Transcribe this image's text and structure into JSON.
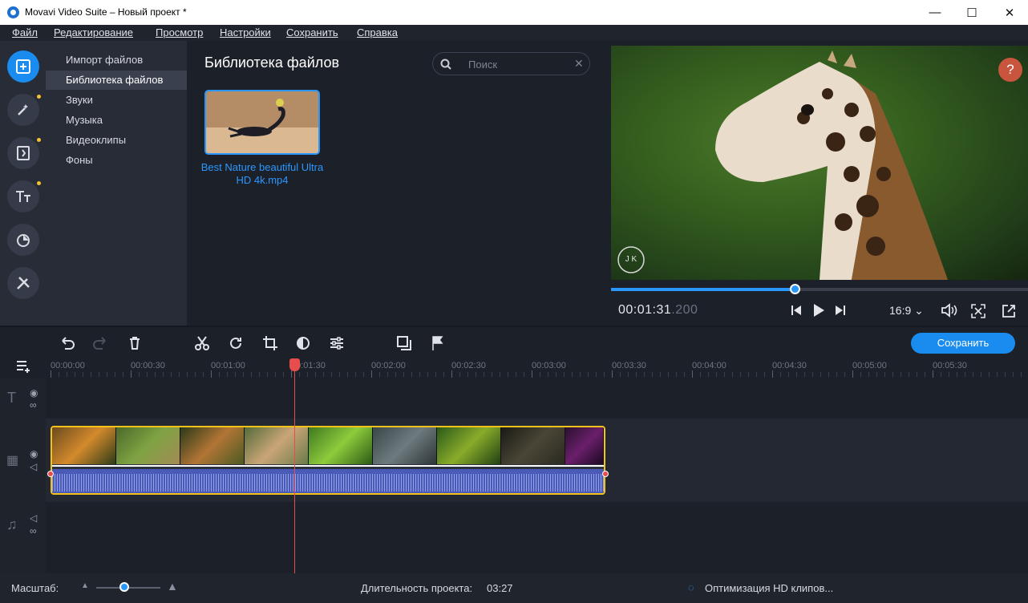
{
  "window": {
    "title": "Movavi Video Suite – Новый проект *",
    "minimize": "—",
    "maximize": "☐",
    "close": "✕"
  },
  "menu": [
    "Файл",
    "Редактирование",
    "Просмотр",
    "Настройки",
    "Сохранить",
    "Справка"
  ],
  "sidebar_tools": [
    {
      "name": "import-icon",
      "active": true,
      "dot": false
    },
    {
      "name": "magic-wand-icon",
      "active": false,
      "dot": true
    },
    {
      "name": "transitions-icon",
      "active": false,
      "dot": true
    },
    {
      "name": "titles-icon",
      "active": false,
      "dot": true
    },
    {
      "name": "filters-icon",
      "active": false,
      "dot": false
    },
    {
      "name": "tools-icon",
      "active": false,
      "dot": false
    }
  ],
  "categories": [
    "Импорт файлов",
    "Библиотека файлов",
    "Звуки",
    "Музыка",
    "Видеоклипы",
    "Фоны"
  ],
  "active_category": 1,
  "library": {
    "title": "Библиотека файлов",
    "search_placeholder": "Поиск",
    "file_label": "Best Nature beautiful Ultra HD 4k.mp4"
  },
  "player": {
    "help": "?",
    "time_main": "00:01:31",
    "time_ms": ".200",
    "aspect": "16:9 ⌄",
    "progress": 0.44,
    "watermark": "J K"
  },
  "toolbar": {
    "save_label": "Сохранить"
  },
  "ruler_ticks": [
    "00:00:00",
    "00:00:30",
    "00:01:00",
    "00:01:30",
    "00:02:00",
    "00:02:30",
    "00:03:00",
    "00:03:30",
    "00:04:00",
    "00:04:30",
    "00:05:00",
    "00:05:30"
  ],
  "status": {
    "zoom_label": "Масштаб:",
    "zoom_level": 0.44,
    "duration_label": "Длительность проекта:",
    "duration_value": "03:27",
    "optimization": "Оптимизация HD клипов..."
  },
  "colors": {
    "accent": "#1a8cf0",
    "clip_border": "#f5c21a",
    "playhead": "#e84d4d",
    "help_button": "#c9553e"
  }
}
